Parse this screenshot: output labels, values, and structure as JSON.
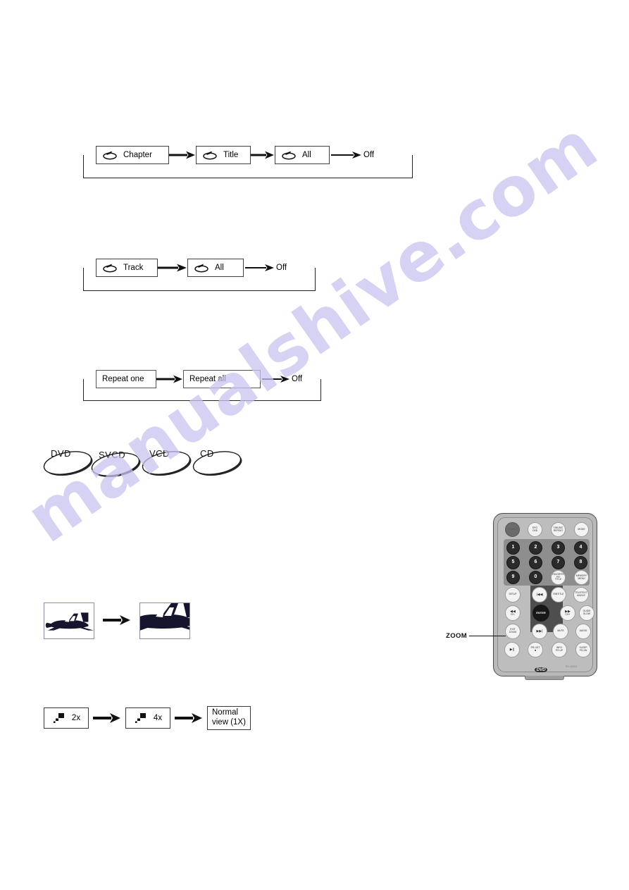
{
  "page": {
    "watermark": "manualshive.com"
  },
  "flows": [
    {
      "name": "dvd-repeat-flow",
      "steps": [
        {
          "icon": "repeat-icon",
          "label": "Chapter"
        },
        {
          "icon": "repeat-icon",
          "label": "Title"
        },
        {
          "icon": "repeat-icon",
          "label": "All"
        }
      ],
      "terminal": "Off"
    },
    {
      "name": "track-repeat-flow",
      "steps": [
        {
          "icon": "repeat-icon",
          "label": "Track"
        },
        {
          "icon": "repeat-icon",
          "label": "All"
        }
      ],
      "terminal": "Off"
    },
    {
      "name": "repeat-mode-flow",
      "steps": [
        {
          "icon": "none",
          "label": "Repeat one"
        },
        {
          "icon": "none",
          "label": "Repeat all"
        }
      ],
      "terminal": "Off"
    }
  ],
  "disc_badges": [
    {
      "label": "DVD"
    },
    {
      "label": "SVCD"
    },
    {
      "label": "VCD"
    },
    {
      "label": "CD"
    }
  ],
  "plane_demo": {
    "before_alt": "airplane-normal-view",
    "after_alt": "airplane-zoomed-view",
    "arrow": "arrow-right-icon"
  },
  "zoom_sequence": {
    "steps": [
      {
        "icon": "magnify-icon",
        "label": "2x"
      },
      {
        "icon": "magnify-icon",
        "label": "4x"
      },
      {
        "icon": "none",
        "label_line1": "Normal",
        "label_line2": "view (1X)"
      }
    ]
  },
  "callout": {
    "label": "ZOOM"
  },
  "remote": {
    "brand_logo": "DVD",
    "brand_sub": "VIDEO",
    "model_code": "RC-6612",
    "rows": [
      [
        {
          "id": "power",
          "style": "power",
          "lines": [
            "POWER"
          ]
        },
        {
          "id": "epg-osd",
          "style": "light",
          "lines": [
            "EPG",
            "OSD"
          ]
        },
        {
          "id": "title-music-repeat",
          "style": "light",
          "lines": [
            "T/MUSIC",
            "REPEAT"
          ]
        },
        {
          "id": "mode",
          "style": "light",
          "lines": [
            "MODE"
          ]
        }
      ],
      [
        {
          "id": "num-1",
          "style": "dark",
          "lines": [
            "1"
          ]
        },
        {
          "id": "num-2",
          "style": "dark",
          "lines": [
            "2"
          ]
        },
        {
          "id": "num-3",
          "style": "dark",
          "lines": [
            "3"
          ]
        },
        {
          "id": "num-4",
          "style": "dark",
          "lines": [
            "4"
          ]
        }
      ],
      [
        {
          "id": "num-5",
          "style": "dark",
          "lines": [
            "5"
          ]
        },
        {
          "id": "num-6",
          "style": "dark",
          "lines": [
            "6"
          ]
        },
        {
          "id": "num-7",
          "style": "dark",
          "lines": [
            "7"
          ]
        },
        {
          "id": "num-8",
          "style": "dark",
          "lines": [
            "8"
          ]
        }
      ],
      [
        {
          "id": "num-9",
          "style": "dark",
          "lines": [
            "9"
          ]
        },
        {
          "id": "num-0",
          "style": "dark",
          "lines": [
            "0"
          ]
        },
        {
          "id": "favorite-title",
          "style": "light",
          "lines": [
            "FAVORITE",
            "PR",
            "TITLE"
          ]
        },
        {
          "id": "memory-menu",
          "style": "light",
          "lines": [
            "MEMORY",
            "MENU"
          ]
        }
      ],
      [
        {
          "id": "setup",
          "style": "light",
          "lines": [
            "SETUP"
          ]
        },
        {
          "id": "prev-track",
          "style": "light",
          "lines": [
            "|◀◀"
          ]
        },
        {
          "id": "subtitle",
          "style": "light",
          "lines": [
            "R/BTITLE"
          ]
        },
        {
          "id": "teletext-angle",
          "style": "light",
          "lines": [
            "TELETEXT",
            "ANGLE"
          ]
        }
      ],
      [
        {
          "id": "ch-down",
          "style": "light",
          "lines": [
            "◀◀",
            "CH-"
          ]
        },
        {
          "id": "enter",
          "style": "enter",
          "lines": [
            "ENTER"
          ]
        },
        {
          "id": "ch-up",
          "style": "light",
          "lines": [
            "▶▶",
            "CH+"
          ]
        },
        {
          "id": "guide-slow",
          "style": "light",
          "lines": [
            "GUIDE",
            "SLOW"
          ]
        }
      ],
      [
        {
          "id": "exit-zoom",
          "style": "light",
          "lines": [
            "EXIT",
            "ZOOM"
          ]
        },
        {
          "id": "next-track",
          "style": "light",
          "lines": [
            "▶▶|"
          ]
        },
        {
          "id": "mute",
          "style": "light",
          "lines": [
            "MUTE"
          ]
        },
        {
          "id": "audio",
          "style": "light",
          "lines": [
            "AUDIO"
          ]
        }
      ],
      [
        {
          "id": "play-pause",
          "style": "light",
          "lines": [
            "▶||"
          ]
        },
        {
          "id": "pr-list-stop",
          "style": "light",
          "lines": [
            "PR LIST",
            "■"
          ]
        },
        {
          "id": "info-pg-up",
          "style": "light",
          "lines": [
            "INFO",
            "PG UP"
          ]
        },
        {
          "id": "sleep-pg-dn",
          "style": "light",
          "lines": [
            "SLEEP",
            "PG DN"
          ]
        }
      ]
    ]
  }
}
